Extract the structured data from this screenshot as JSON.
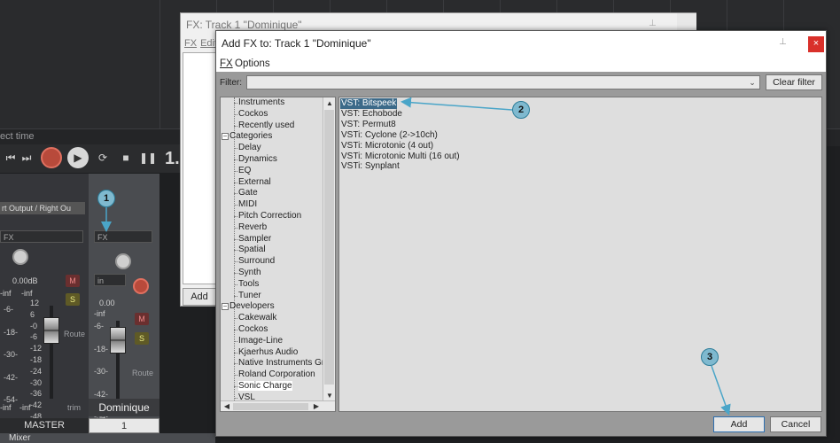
{
  "daw": {
    "select_time_label": "ect time",
    "time_display": "1.",
    "output_label": "rt Output / Right Ou",
    "fx_slot_master": "FX",
    "fx_slot_track": "FX",
    "master_db": "0.00dB",
    "track_db": "0.00",
    "master_inf_left": "-inf",
    "master_inf_right": "-inf",
    "track_inf": "-inf",
    "master_inf_bottom_left": "-inf",
    "master_inf_bottom_right": "-inf",
    "in_label": "in",
    "mute_label": "M",
    "solo_label": "S",
    "route_label": "Route",
    "trim_label": "trim",
    "scale_master": [
      "12",
      "6",
      "-0",
      "-6",
      "-12",
      "-18",
      "-24",
      "-30",
      "-36",
      "-42",
      "-48",
      "-54"
    ],
    "scale_left": [
      "-6-",
      "-18-",
      "-30-",
      "-42-",
      "-54-"
    ],
    "scale_track": [
      "-6-",
      "-18-",
      "-30-",
      "-42-",
      "-54-"
    ],
    "track_name": "Dominique",
    "master_label": "MASTER",
    "track_number": "1",
    "mixer_tab": "Mixer"
  },
  "fx_window": {
    "title": "FX: Track 1 \"Dominique\"",
    "menu_fx": "FX",
    "menu_edit": "Edit",
    "add_label": "Add"
  },
  "dialog": {
    "title": "Add FX to: Track 1 \"Dominique\"",
    "menu": [
      "FX",
      "Options"
    ],
    "filter_label": "Filter:",
    "filter_value": "",
    "clear_filter_label": "Clear filter",
    "add_label": "Add",
    "cancel_label": "Cancel",
    "close_label": "×"
  },
  "tree": [
    {
      "label": "Instruments",
      "level": "child"
    },
    {
      "label": "Cockos",
      "level": "child"
    },
    {
      "label": "Recently used",
      "level": "child"
    },
    {
      "label": "Categories",
      "level": "parent",
      "expanded": true
    },
    {
      "label": "Delay",
      "level": "child"
    },
    {
      "label": "Dynamics",
      "level": "child"
    },
    {
      "label": "EQ",
      "level": "child"
    },
    {
      "label": "External",
      "level": "child"
    },
    {
      "label": "Gate",
      "level": "child"
    },
    {
      "label": "MIDI",
      "level": "child"
    },
    {
      "label": "Pitch Correction",
      "level": "child"
    },
    {
      "label": "Reverb",
      "level": "child"
    },
    {
      "label": "Sampler",
      "level": "child"
    },
    {
      "label": "Spatial",
      "level": "child"
    },
    {
      "label": "Surround",
      "level": "child"
    },
    {
      "label": "Synth",
      "level": "child"
    },
    {
      "label": "Tools",
      "level": "child"
    },
    {
      "label": "Tuner",
      "level": "child"
    },
    {
      "label": "Developers",
      "level": "parent",
      "expanded": true
    },
    {
      "label": "Cakewalk",
      "level": "child"
    },
    {
      "label": "Cockos",
      "level": "child"
    },
    {
      "label": "Image-Line",
      "level": "child"
    },
    {
      "label": "Kjaerhus Audio",
      "level": "child"
    },
    {
      "label": "Native Instruments Gr",
      "level": "child"
    },
    {
      "label": "Roland Corporation",
      "level": "child"
    },
    {
      "label": "Sonic Charge",
      "level": "child",
      "selected": true
    },
    {
      "label": "VSL",
      "level": "child"
    }
  ],
  "plugins": [
    {
      "label": "VST: Bitspeek",
      "selected": true
    },
    {
      "label": "VST: Echobode"
    },
    {
      "label": "VST: Permut8"
    },
    {
      "label": "VSTi: Cyclone (2->10ch)"
    },
    {
      "label": "VSTi: Microtonic (4 out)"
    },
    {
      "label": "VSTi: Microtonic Multi (16 out)"
    },
    {
      "label": "VSTi: Synplant"
    }
  ],
  "callouts": [
    "1",
    "2",
    "3"
  ],
  "colors": {
    "selection": "#3c6a89",
    "callout": "#7fb9cf",
    "close_button": "#d9302a",
    "record_button": "#b84a3b"
  },
  "icons": {
    "collapse": "−",
    "scroll_up": "▲",
    "scroll_down": "▼",
    "scroll_left": "◀",
    "scroll_right": "▶",
    "dropdown": "⌄",
    "pin": "⊥"
  }
}
